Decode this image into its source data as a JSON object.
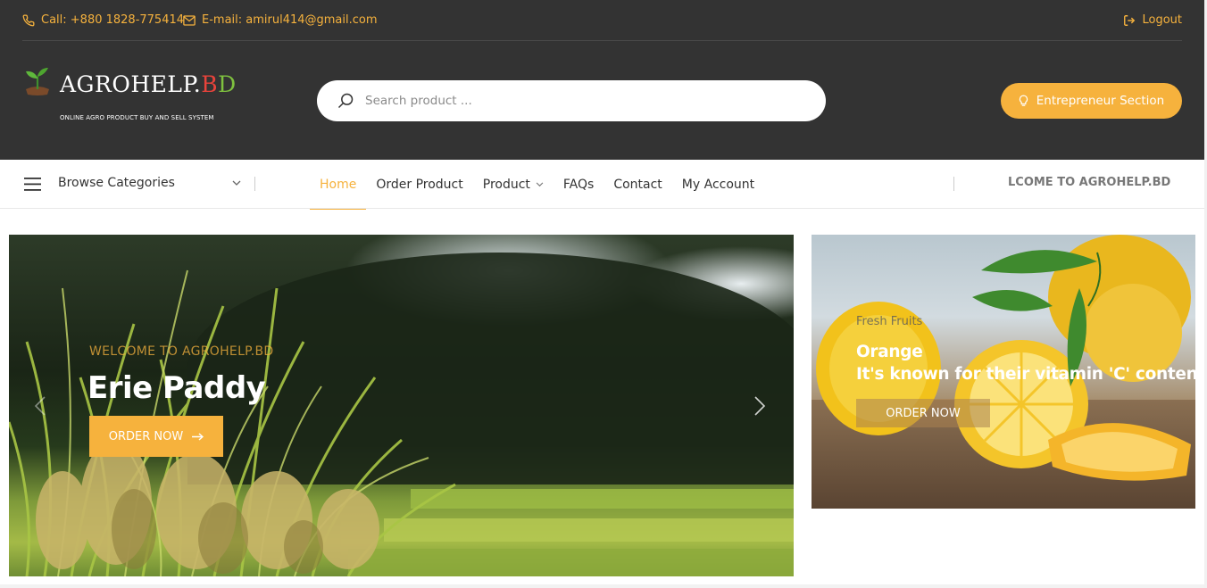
{
  "topbar": {
    "call_text": "Call: +880 1828-775414",
    "email_text": "E-mail: amirul414@gmail.com",
    "logout_text": "Logout"
  },
  "logo": {
    "name_main": "AGROHELP.",
    "name_bd_b": "B",
    "name_bd_d": "D",
    "tagline": "ONLINE AGRO PRODUCT BUY AND SELL SYSTEM"
  },
  "search": {
    "placeholder": "Search product ..."
  },
  "entrepreneur_button": "Entrepreneur Section",
  "nav": {
    "browse_label": "Browse Categories",
    "links": [
      "Home",
      "Order Product",
      "Product",
      "FAQs",
      "Contact",
      "My Account"
    ],
    "active": "Home",
    "marquee": "LCOME TO AGROHELP.BD"
  },
  "hero": {
    "subtitle": "WELCOME TO AGROHELP.BD",
    "title": "Erie Paddy",
    "button": "ORDER NOW"
  },
  "side_banner": {
    "subtitle": "Fresh Fruits",
    "title_line1": "Orange",
    "title_line2": "It's known for their vitamin 'C' content.",
    "button": "ORDER NOW"
  },
  "colors": {
    "accent": "#f6b23d",
    "header_bg": "#333333",
    "logo_b": "#e8433b",
    "logo_d": "#7fc13f"
  }
}
